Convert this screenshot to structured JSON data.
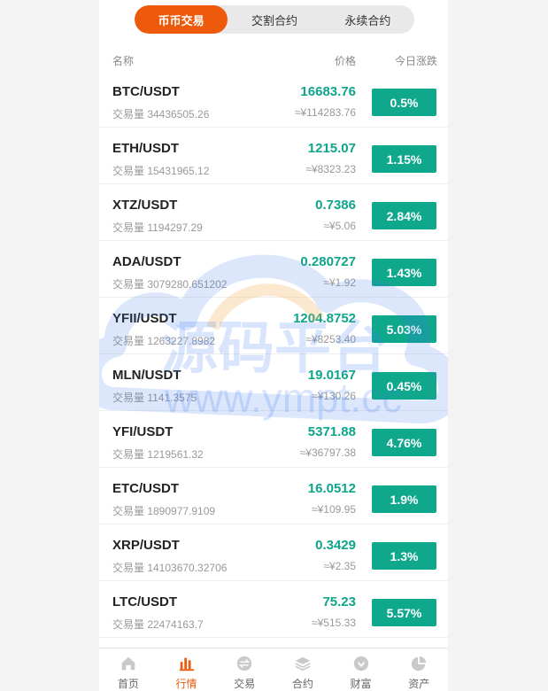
{
  "tabs": [
    {
      "label": "币币交易"
    },
    {
      "label": "交割合约"
    },
    {
      "label": "永续合约"
    }
  ],
  "columns": {
    "name": "名称",
    "price": "价格",
    "change": "今日涨跌"
  },
  "markets": [
    {
      "pair": "BTC/USDT",
      "volume": "交易量 34436505.26",
      "price": "16683.76",
      "cny": "≈¥114283.76",
      "change": "0.5%"
    },
    {
      "pair": "ETH/USDT",
      "volume": "交易量 15431965.12",
      "price": "1215.07",
      "cny": "≈¥8323.23",
      "change": "1.15%"
    },
    {
      "pair": "XTZ/USDT",
      "volume": "交易量 1194297.29",
      "price": "0.7386",
      "cny": "≈¥5.06",
      "change": "2.84%"
    },
    {
      "pair": "ADA/USDT",
      "volume": "交易量 3079280.651202",
      "price": "0.280727",
      "cny": "≈¥1.92",
      "change": "1.43%"
    },
    {
      "pair": "YFII/USDT",
      "volume": "交易量 1263227.8982",
      "price": "1204.8752",
      "cny": "≈¥8253.40",
      "change": "5.03%"
    },
    {
      "pair": "MLN/USDT",
      "volume": "交易量 1141.3575",
      "price": "19.0167",
      "cny": "≈¥130.26",
      "change": "0.45%"
    },
    {
      "pair": "YFI/USDT",
      "volume": "交易量 1219561.32",
      "price": "5371.88",
      "cny": "≈¥36797.38",
      "change": "4.76%"
    },
    {
      "pair": "ETC/USDT",
      "volume": "交易量 1890977.9109",
      "price": "16.0512",
      "cny": "≈¥109.95",
      "change": "1.9%"
    },
    {
      "pair": "XRP/USDT",
      "volume": "交易量 14103670.32706",
      "price": "0.3429",
      "cny": "≈¥2.35",
      "change": "1.3%"
    },
    {
      "pair": "LTC/USDT",
      "volume": "交易量 22474163.7",
      "price": "75.23",
      "cny": "≈¥515.33",
      "change": "5.57%"
    }
  ],
  "tabbar": [
    {
      "label": "首页",
      "icon": "home-icon"
    },
    {
      "label": "行情",
      "icon": "market-chart-icon"
    },
    {
      "label": "交易",
      "icon": "exchange-icon"
    },
    {
      "label": "合约",
      "icon": "layers-icon"
    },
    {
      "label": "财富",
      "icon": "wealth-icon"
    },
    {
      "label": "资产",
      "icon": "pie-chart-icon"
    }
  ],
  "watermark": {
    "title": "源码平台",
    "url": "www.ympt.cc"
  },
  "colors": {
    "accent": "#ee5a0c",
    "up": "#10a88c",
    "price": "#0ea58b"
  }
}
